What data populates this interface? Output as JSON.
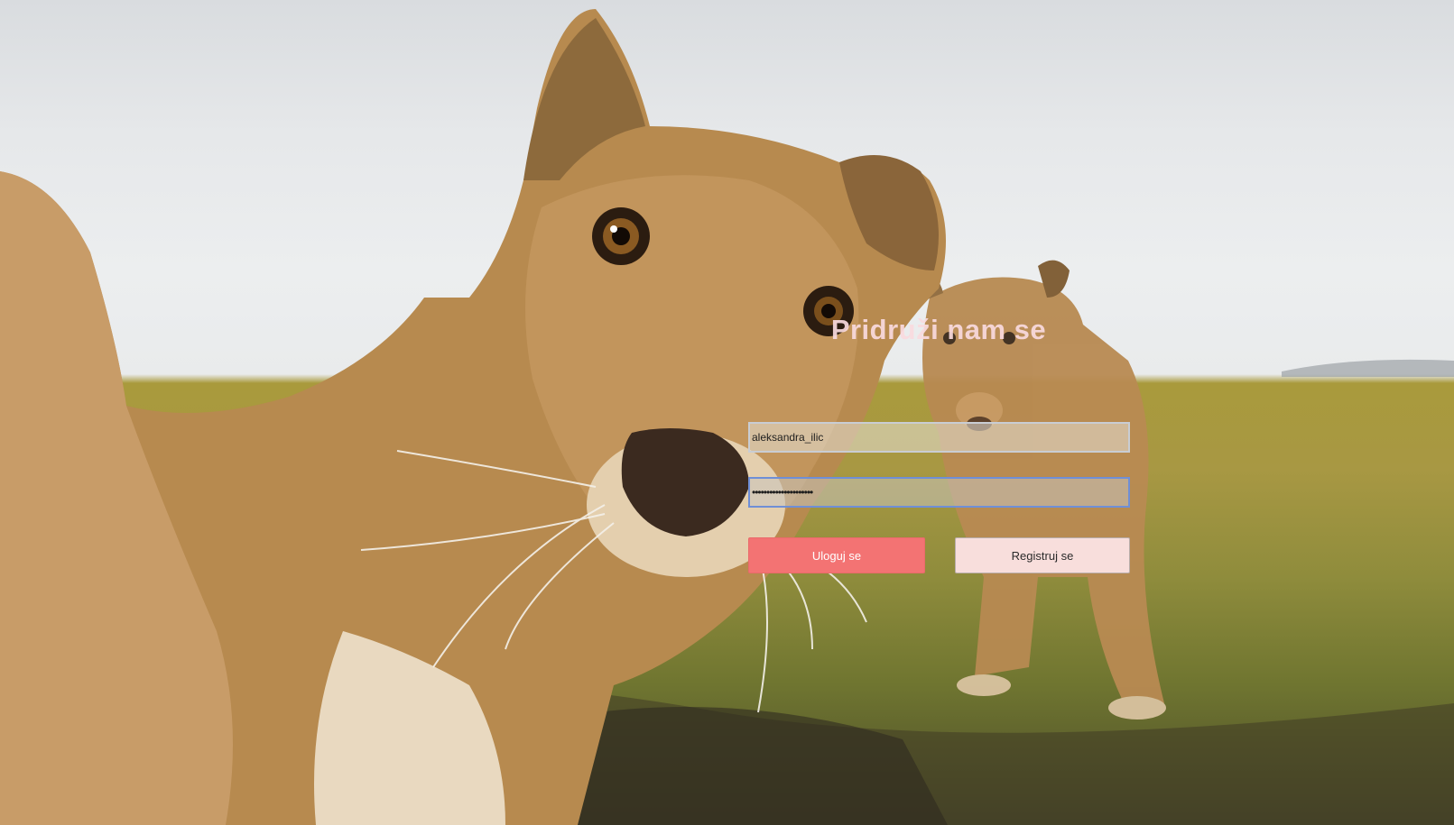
{
  "form": {
    "title": "Pridruži nam se",
    "username_value": "aleksandra_ilic",
    "password_value": "•••••••••••••••••••••",
    "login_label": "Uloguj se",
    "register_label": "Registruj se"
  },
  "colors": {
    "login_button": "#f37373",
    "register_button": "#f8dedc",
    "focus_border": "#6f8fd6"
  }
}
